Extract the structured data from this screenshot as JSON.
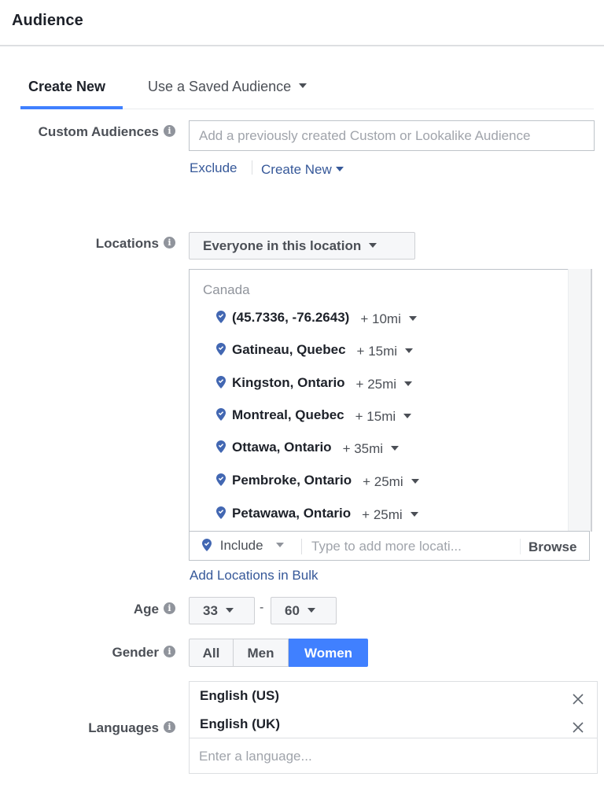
{
  "header": {
    "title": "Audience"
  },
  "tabs": [
    {
      "label": "Create New",
      "active": true
    },
    {
      "label": "Use a Saved Audience",
      "active": false
    }
  ],
  "custom_audiences": {
    "label": "Custom Audiences",
    "placeholder": "Add a previously created Custom or Lookalike Audience",
    "value": "",
    "exclude_label": "Exclude",
    "create_new_label": "Create New"
  },
  "locations": {
    "label": "Locations",
    "type_selected": "Everyone in this location",
    "country": "Canada",
    "items": [
      {
        "name": "(45.7336, -76.2643)",
        "radius": "+ 10mi"
      },
      {
        "name": "Gatineau, Quebec",
        "radius": "+ 15mi"
      },
      {
        "name": "Kingston, Ontario",
        "radius": "+ 25mi"
      },
      {
        "name": "Montreal, Quebec",
        "radius": "+ 15mi"
      },
      {
        "name": "Ottawa, Ontario",
        "radius": "+ 35mi"
      },
      {
        "name": "Pembroke, Ontario",
        "radius": "+ 25mi"
      },
      {
        "name": "Petawawa, Ontario",
        "radius": "+ 25mi"
      }
    ],
    "include_label": "Include",
    "add_placeholder": "Type to add more locati...",
    "browse_label": "Browse",
    "bulk_link": "Add Locations in Bulk"
  },
  "age": {
    "label": "Age",
    "min": "33",
    "max": "60",
    "separator": "-"
  },
  "gender": {
    "label": "Gender",
    "options": [
      "All",
      "Men",
      "Women"
    ],
    "selected": "Women"
  },
  "languages": {
    "label": "Languages",
    "selected": [
      "English (US)",
      "English (UK)"
    ],
    "placeholder": "Enter a language..."
  },
  "colors": {
    "accent": "#4080ff",
    "link": "#365899",
    "pin": "#4267b2",
    "label": "#4b4f56"
  }
}
